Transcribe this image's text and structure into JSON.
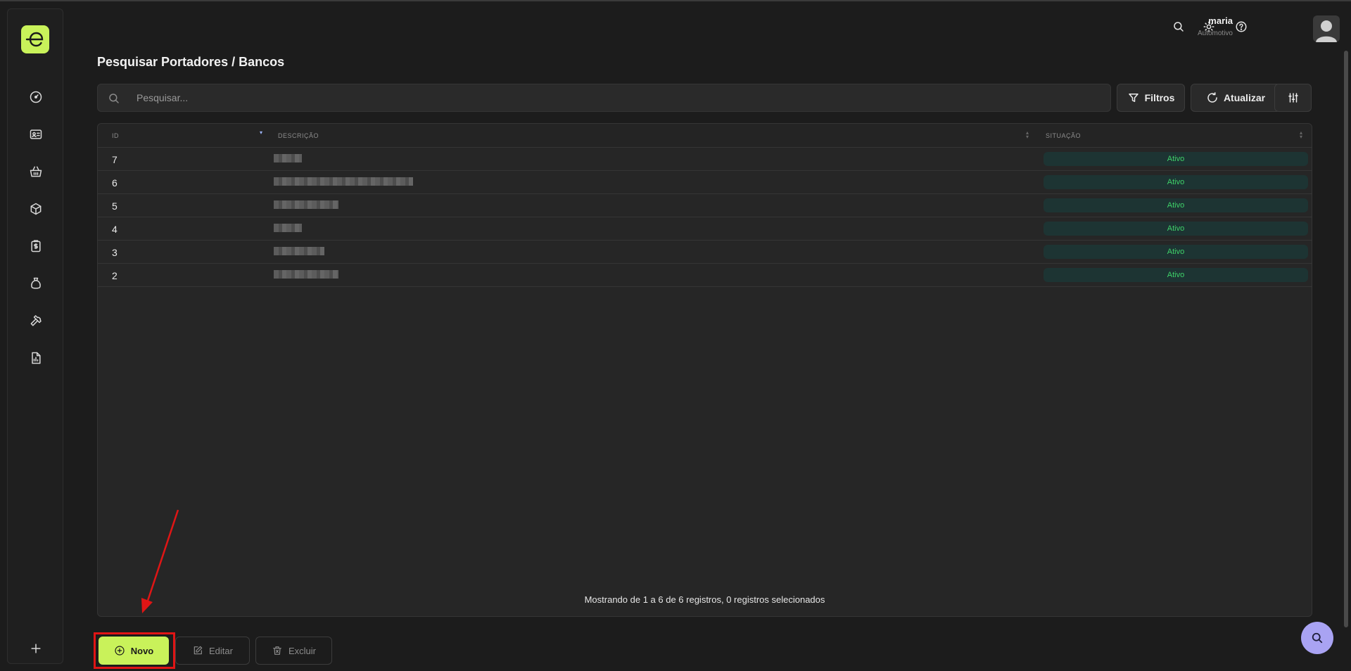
{
  "header": {
    "user_name": "maria",
    "user_org": "Automotivo"
  },
  "page": {
    "title": "Pesquisar Portadores / Bancos"
  },
  "search": {
    "placeholder": "Pesquisar..."
  },
  "toolbar": {
    "filters_label": "Filtros",
    "refresh_label": "Atualizar"
  },
  "table": {
    "columns": [
      "ID",
      "DESCRIÇÃO",
      "SITUAÇÃO"
    ],
    "rows": [
      {
        "id": "7",
        "status": "Ativo"
      },
      {
        "id": "6",
        "status": "Ativo"
      },
      {
        "id": "5",
        "status": "Ativo"
      },
      {
        "id": "4",
        "status": "Ativo"
      },
      {
        "id": "3",
        "status": "Ativo"
      },
      {
        "id": "2",
        "status": "Ativo"
      }
    ],
    "footer": "Mostrando de 1 a 6 de 6 registros, 0 registros selecionados"
  },
  "actions": {
    "new_label": "Novo",
    "edit_label": "Editar",
    "delete_label": "Excluir"
  },
  "sidebar": {
    "items": [
      "dashboard-icon",
      "contacts-icon",
      "basket-icon",
      "box-icon",
      "clipboard-money-icon",
      "money-bag-icon",
      "wrench-icon",
      "report-icon",
      "plus-icon"
    ]
  },
  "colors": {
    "accent": "#c9f25a",
    "status_active": "#3fd36a",
    "annotation": "#e01515",
    "fab": "#a9a3f3"
  }
}
